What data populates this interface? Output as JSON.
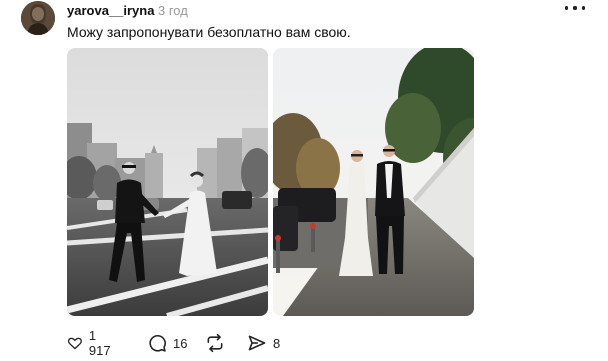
{
  "post": {
    "username": "yarova__iryna",
    "time": "3 год",
    "text": "Можу запропонувати безоплатно вам свою."
  },
  "photos": [
    {
      "style": "black-and-white",
      "subject": "wedding-couple-street"
    },
    {
      "style": "color",
      "subject": "wedding-couple-embankment"
    }
  ],
  "actions": {
    "likes": "1 917",
    "replies": "16",
    "reposts": "",
    "shares": "8"
  },
  "icons": {
    "more": "more-horizontal-icon",
    "like": "heart-icon",
    "reply": "comment-icon",
    "repost": "repost-icon",
    "share": "send-icon"
  },
  "colors": {
    "text": "#101010",
    "muted": "#9a9a9a",
    "background": "#ffffff"
  }
}
